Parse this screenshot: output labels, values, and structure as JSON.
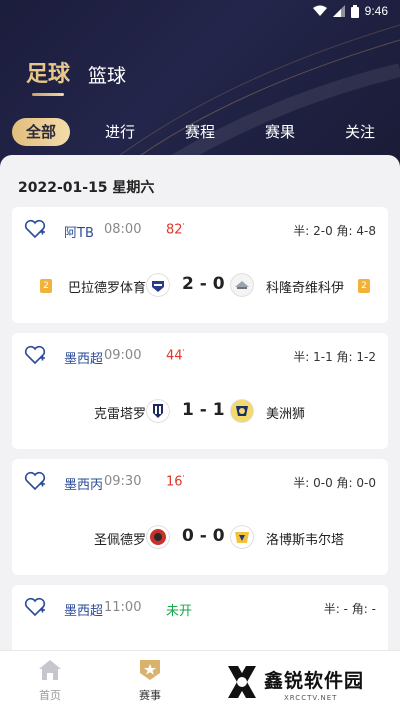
{
  "status_bar": {
    "time": "9:46"
  },
  "sport_tabs": [
    {
      "label": "足球",
      "active": true
    },
    {
      "label": "篮球",
      "active": false
    }
  ],
  "filter_tabs": [
    {
      "label": "全部",
      "active": true
    },
    {
      "label": "进行",
      "active": false
    },
    {
      "label": "赛程",
      "active": false
    },
    {
      "label": "赛果",
      "active": false
    },
    {
      "label": "关注",
      "active": false
    }
  ],
  "date_header": "2022-01-15 星期六",
  "matches": [
    {
      "league": "阿TB",
      "time": "08:00",
      "minute": "82",
      "stats": "半: 2-0  角: 4-8",
      "home": "巴拉德罗体育",
      "home_rank": "2",
      "score": "2 - 0",
      "away": "科隆奇维科伊",
      "away_rank": "2"
    },
    {
      "league": "墨西超",
      "time": "09:00",
      "minute": "44",
      "stats": "半: 1-1  角: 1-2",
      "home": "克雷塔罗",
      "score": "1 - 1",
      "away": "美洲狮"
    },
    {
      "league": "墨西丙",
      "time": "09:30",
      "minute": "16",
      "stats": "半: 0-0  角: 0-0",
      "home": "圣佩德罗",
      "score": "0 - 0",
      "away": "洛博斯韦尔塔"
    },
    {
      "league": "墨西超",
      "time": "11:00",
      "minute": "未开",
      "stats": "半: -  角: -"
    }
  ],
  "bottom_nav": [
    {
      "label": "首页",
      "icon": "home-icon",
      "active": false
    },
    {
      "label": "赛事",
      "icon": "trophy-icon",
      "active": true
    }
  ],
  "watermark": {
    "text": "鑫锐软件园",
    "sub": "XRCCTV.NET"
  },
  "colors": {
    "accent_gold": "#e8c88a",
    "header_bg": "#1f2044",
    "live_red": "#e0362c",
    "not_started_green": "#19a64a",
    "league_blue": "#2c4b9a"
  }
}
